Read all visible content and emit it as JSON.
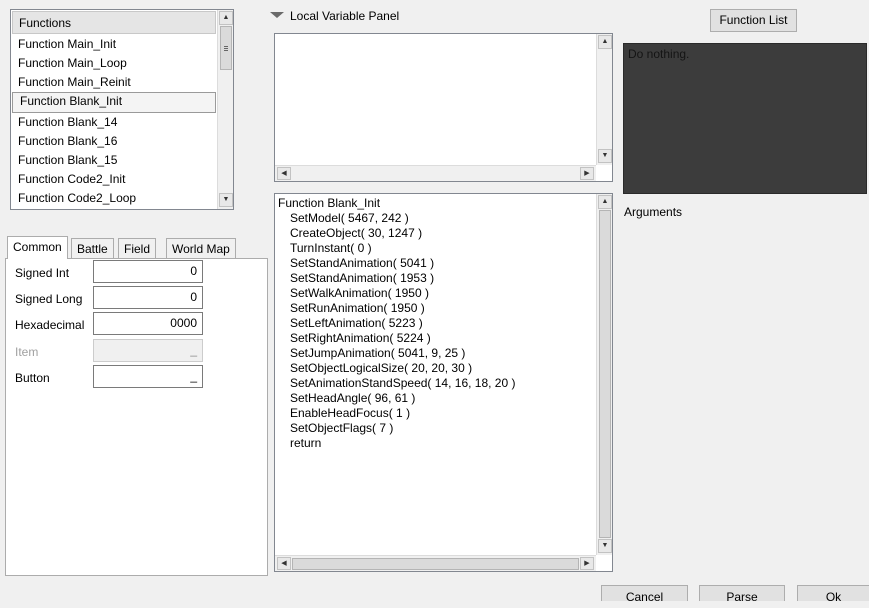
{
  "functions": {
    "header": "Functions",
    "items": [
      "Function Main_Init",
      "Function Main_Loop",
      "Function Main_Reinit",
      "Function Blank_Init",
      "Function Blank_14",
      "Function Blank_16",
      "Function Blank_15",
      "Function Code2_Init",
      "Function Code2_Loop"
    ],
    "selected_index": 3
  },
  "tabs": [
    "Common",
    "Battle",
    "Field",
    "World Map"
  ],
  "active_tab": "Common",
  "common_fields": {
    "signed_int_label": "Signed Int",
    "signed_int_value": "0",
    "signed_long_label": "Signed Long",
    "signed_long_value": "0",
    "hexadecimal_label": "Hexadecimal",
    "hexadecimal_value": "0000",
    "item_label": "Item",
    "item_value": "_",
    "button_label": "Button",
    "button_value": "_"
  },
  "local_variable_panel": {
    "title": "Local Variable Panel"
  },
  "code": {
    "lines": [
      "Function Blank_Init",
      "SetModel( 5467, 242 )",
      "CreateObject( 30, 1247 )",
      "TurnInstant( 0 )",
      "SetStandAnimation( 5041 )",
      "SetStandAnimation( 1953 )",
      "SetWalkAnimation( 1950 )",
      "SetRunAnimation( 1950 )",
      "SetLeftAnimation( 5223 )",
      "SetRightAnimation( 5224 )",
      "SetJumpAnimation( 5041, 9, 25 )",
      "SetObjectLogicalSize( 20, 20, 30 )",
      "SetAnimationStandSpeed( 14, 16, 18, 20 )",
      "SetHeadAngle( 96, 61 )",
      "EnableHeadFocus( 1 )",
      "SetObjectFlags( 7 )",
      "return"
    ]
  },
  "right_panel": {
    "function_list_button": "Function List",
    "description": "Do nothing.",
    "arguments_label": "Arguments"
  },
  "bottom_buttons": {
    "cancel": "Cancel",
    "parse": "Parse",
    "ok": "Ok"
  },
  "colors": {
    "description_bg": "#3c3c3c",
    "window_bg": "#f0f0f0"
  }
}
